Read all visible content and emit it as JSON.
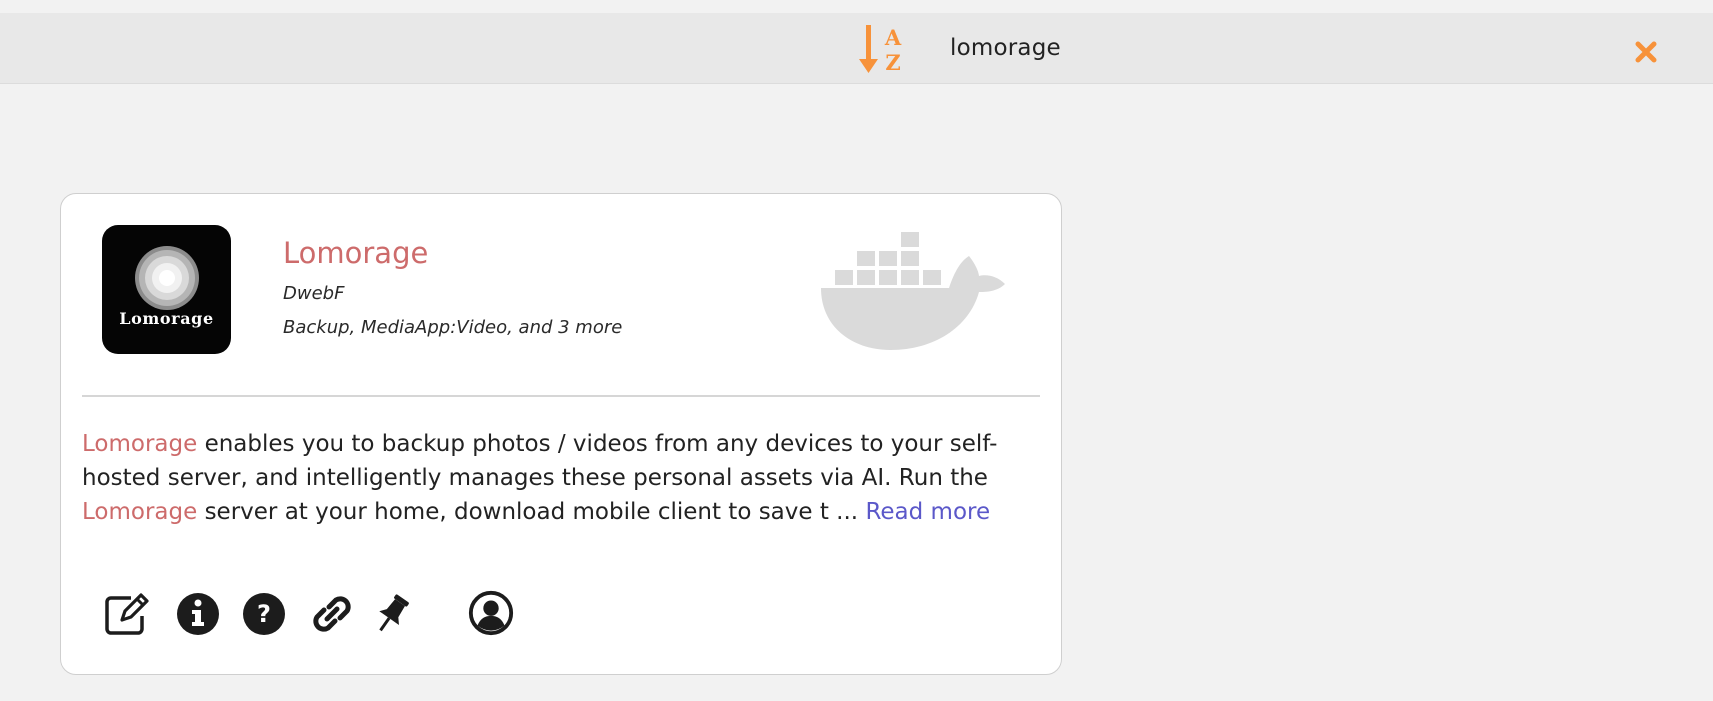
{
  "header": {
    "sort_icon": "sort-alpha-down-icon",
    "search_value": "lomorage",
    "close_icon": "close-icon",
    "accent_color": "#f7923a"
  },
  "card": {
    "logo_text": "Lomorage",
    "title": "Lomorage",
    "author": "DwebF",
    "categories": "Backup, MediaApp:Video, and 3 more",
    "platform_icon": "docker-whale-icon",
    "description": {
      "part1_highlight": "Lomorage",
      "part1": " enables you to backup photos / videos from any devices to your self-hosted server, and intelligently manages these personal assets via AI. Run the ",
      "part2_highlight": "Lomorage",
      "part2": " server at your home, download mobile client to save t ... ",
      "read_more": "Read more"
    },
    "title_color": "#cd6b6b",
    "link_color": "#5b58c9",
    "actions": [
      {
        "name": "edit-icon"
      },
      {
        "name": "info-icon"
      },
      {
        "name": "help-icon"
      },
      {
        "name": "link-icon"
      },
      {
        "name": "pin-icon"
      },
      {
        "name": "user-icon"
      }
    ]
  }
}
